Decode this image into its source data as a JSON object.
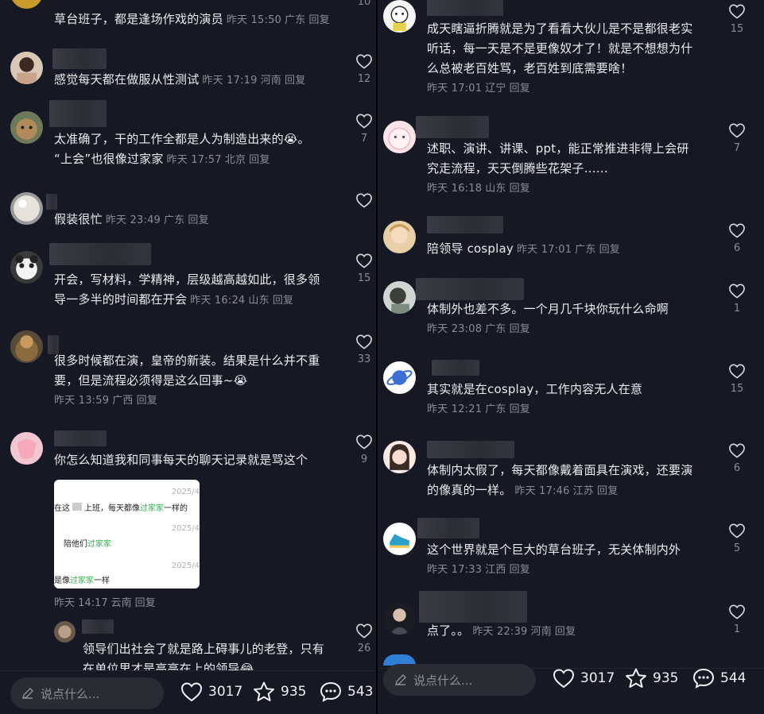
{
  "left": {
    "comments": [
      {
        "text": "草台班子，都是逢场作戏的演员",
        "time": "昨天 15:50",
        "region": "广东",
        "reply": "回复",
        "likes": "10"
      },
      {
        "text": "感觉每天都在做服从性测试",
        "time": "昨天 17:19",
        "region": "河南",
        "reply": "回复",
        "likes": "12"
      },
      {
        "text1": "太准确了，干的工作全都是人为制造出来的😭。",
        "text2": "“上会”也很像过家家",
        "time": "昨天 17:57",
        "region": "北京",
        "reply": "回复",
        "likes": "7"
      },
      {
        "text": "假装很忙",
        "time": "昨天 23:49",
        "region": "广东",
        "reply": "回复",
        "likes": ""
      },
      {
        "text1": "开会，写材料，学精神，层级越高越如此，很多领",
        "text2": "导一多半的时间都在开会",
        "time": "昨天 16:24",
        "region": "山东",
        "reply": "回复",
        "likes": "15"
      },
      {
        "text1": "很多时候都在演，皇帝的新装。结果是什么并不重",
        "text2": "要，但是流程必须得是这么回事~😭",
        "time": "昨天 13:59",
        "region": "广西",
        "reply": "回复",
        "likes": "33"
      },
      {
        "text": "你怎么知道我和同事每天的聊天记录就是骂这个",
        "time": "昨天 14:17",
        "region": "云南",
        "reply": "回复",
        "likes": "9",
        "image": {
          "date1": "2025/4",
          "date2": "2025/4",
          "date3": "2025/4",
          "l1a": "在这",
          "l1b": "上班，每天都像",
          "l1c": "过家家",
          "l1d": "一样的",
          "l2a": "陪他们",
          "l2b": "过家家",
          "l3a": "是像",
          "l3b": "过家家",
          "l3c": "一样"
        }
      },
      {
        "text1": "领导们出社会了就是路上碍事儿的老登，只有",
        "text2": "在单位里才是高高在上的领导😂",
        "likes": "26"
      }
    ],
    "bar": {
      "placeholder": "说点什么...",
      "likes": "3017",
      "favorites": "935",
      "comments": "543"
    }
  },
  "right": {
    "comments": [
      {
        "likes": "15"
      },
      {
        "text1": "成天瞎逼折腾就是为了看看大伙儿是不是都很老实",
        "text2": "听话，每一天是不是更像奴才了！就是不想想为什",
        "text3": "么总被老百姓骂，老百姓到底需要啥！",
        "time": "昨天 17:01",
        "region": "辽宁",
        "reply": "回复"
      },
      {
        "text1": "述职、演讲、讲课、ppt，能正常推进非得上会研",
        "text2": "究走流程，天天倒腾些花架子……",
        "time": "昨天 16:18",
        "region": "山东",
        "reply": "回复",
        "likes": "7"
      },
      {
        "text": "陪领导 cosplay",
        "time": "昨天 17:01",
        "region": "广东",
        "reply": "回复",
        "likes": "6"
      },
      {
        "text": "体制外也差不多。一个月几千块你玩什么命啊",
        "time": "昨天 23:08",
        "region": "广东",
        "reply": "回复",
        "likes": "1"
      },
      {
        "text": "其实就是在cosplay，工作内容无人在意",
        "time": "昨天 12:21",
        "region": "广东",
        "reply": "回复",
        "likes": "15"
      },
      {
        "text1": "体制内太假了，每天都像戴着面具在演戏，还要演",
        "text2": "的像真的一样。",
        "time": "昨天 17:46",
        "region": "江苏",
        "reply": "回复",
        "likes": "6"
      },
      {
        "text": "这个世界就是个巨大的草台班子，无关体制内外",
        "time": "昨天 17:33",
        "region": "江西",
        "reply": "回复",
        "likes": "5"
      },
      {
        "text": "点了。。",
        "time": "昨天 22:39",
        "region": "河南",
        "reply": "回复",
        "likes": "1"
      }
    ],
    "bar": {
      "placeholder": "说点什么...",
      "likes": "3017",
      "favorites": "935",
      "comments": "544"
    }
  },
  "colors": {
    "background": "#161823",
    "text": "#ececef",
    "meta": "#8b8c94",
    "accent_green": "#2bb24c"
  },
  "icons": [
    "heart-icon",
    "star-icon",
    "comment-icon",
    "pencil-icon"
  ]
}
